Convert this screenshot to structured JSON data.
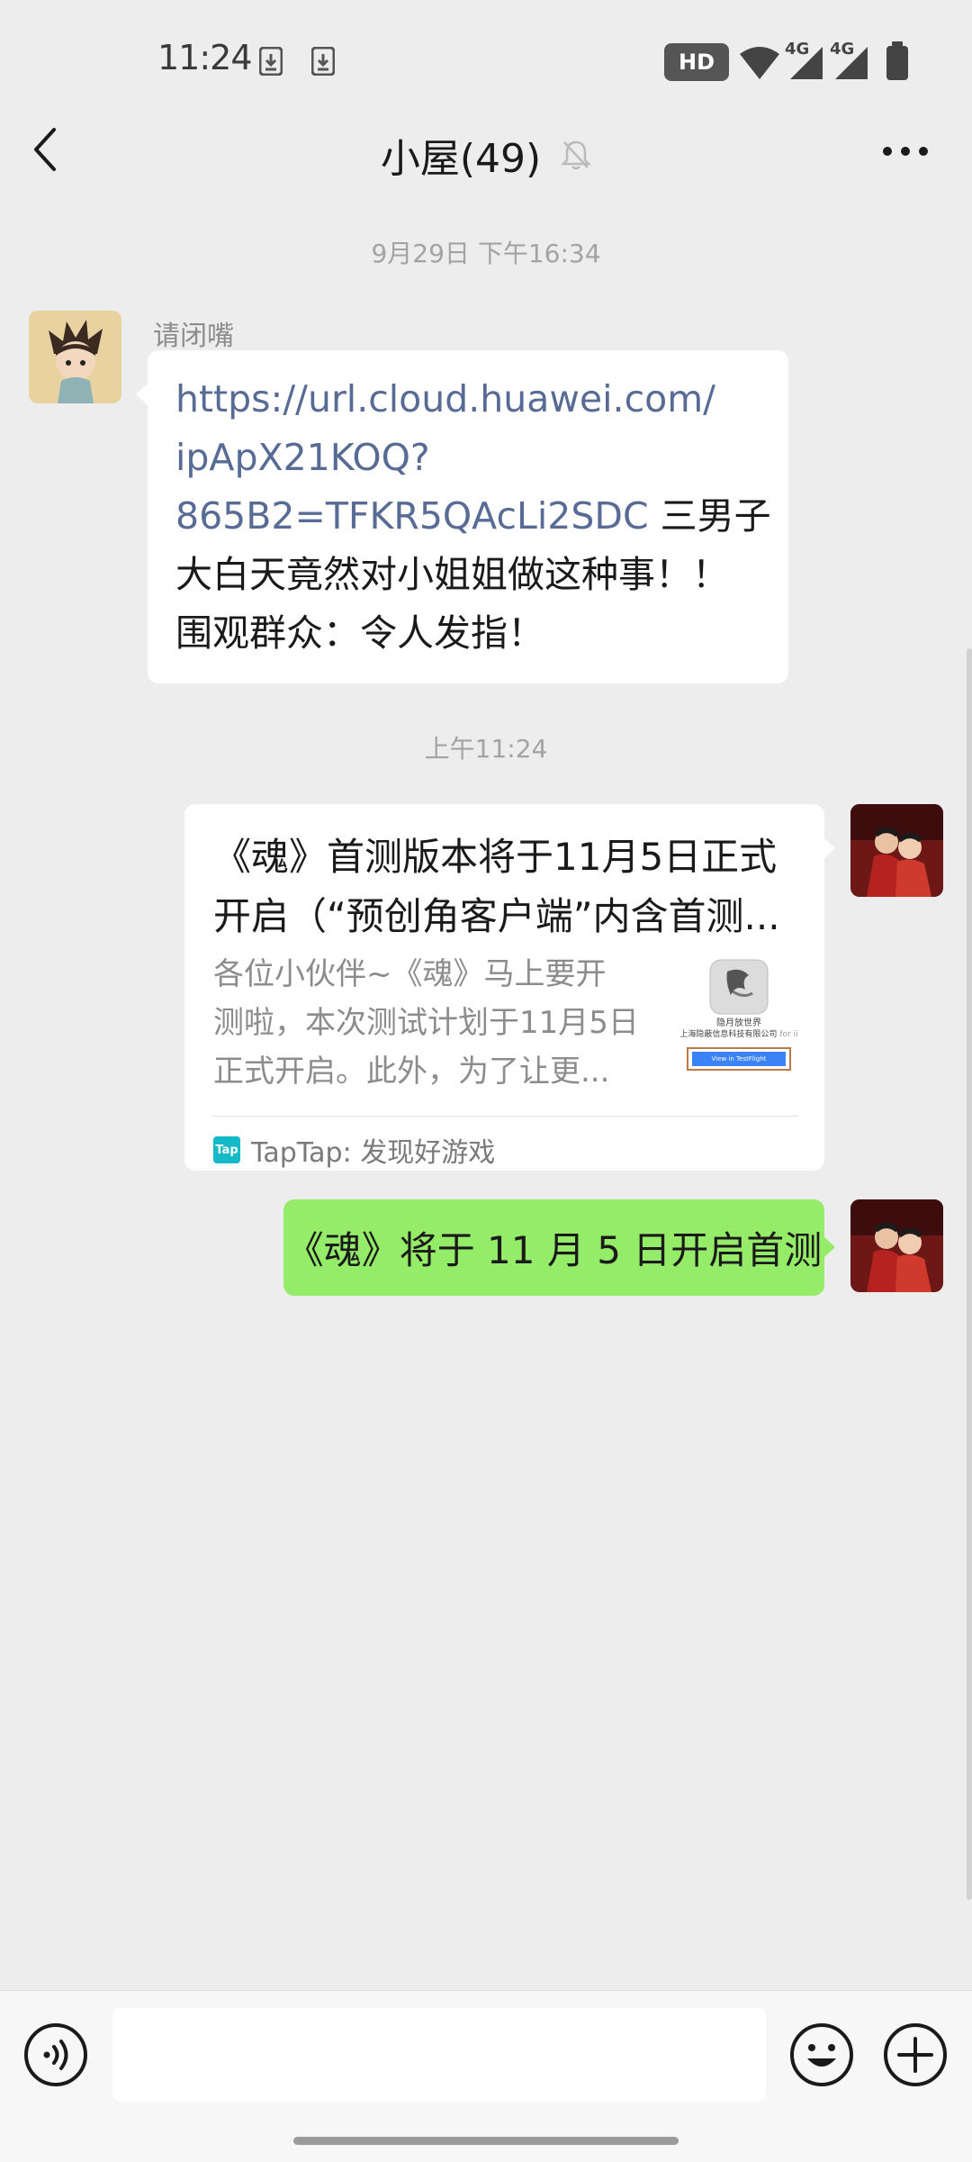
{
  "status_bar": {
    "time": "11:24",
    "hd_label": "HD",
    "network_labels": [
      "4G",
      "4G"
    ],
    "icons": [
      "download-icon",
      "download-icon",
      "hd-icon",
      "wifi-icon",
      "signal-icon",
      "signal-icon",
      "battery-icon"
    ]
  },
  "header": {
    "title": "小屋(49)",
    "back_icon": "chevron-left-icon",
    "mute_icon": "bell-muted-icon",
    "more_icon": "more-dots-icon"
  },
  "messages": [
    {
      "type": "timestamp",
      "text": "9月29日 下午16:34"
    },
    {
      "type": "text",
      "direction": "incoming",
      "sender": "请闭嘴",
      "link": "https://url.cloud.huawei.com/ipApX21KOQ?865B2=TFKR5QAcLi2SDC",
      "link_lines": [
        "https://url.cloud.huawei.com/",
        "ipApX21KOQ?",
        "865B2=TFKR5QAcLi2SDC"
      ],
      "text_tail": " 三男子",
      "text_lines": [
        "大白天竟然对小姐姐做这种事！！",
        "围观群众：令人发指！"
      ]
    },
    {
      "type": "timestamp",
      "text": "上午11:24"
    },
    {
      "type": "link_card",
      "direction": "outgoing",
      "title_lines": [
        "《魂》首测版本将于11月5日正式",
        "开启（“预创角客户端”内含首测..."
      ],
      "desc_lines": [
        "各位小伙伴~《魂》马上要开",
        "测啦，本次测试计划于11月5日",
        "正式开启。此外，为了让更..."
      ],
      "thumbnail": {
        "caption_1": "隐月放世界",
        "caption_2": "上海隐蔽信息科技有限公司",
        "caption_3": "for ii",
        "button": "View in TestFlight"
      },
      "source_logo": "Tap",
      "source": "TapTap: 发现好游戏"
    },
    {
      "type": "text",
      "direction": "outgoing",
      "text": "《魂》将于 11 月 5 日开启首测"
    }
  ],
  "input_bar": {
    "voice_icon": "voice-icon",
    "input_value": "",
    "emoji_icon": "emoji-icon",
    "plus_icon": "plus-icon"
  },
  "colors": {
    "background": "#ededed",
    "outgoing_bubble": "#95ec69",
    "incoming_bubble": "#ffffff",
    "link": "#576b95",
    "timestamp": "#a3a3a3",
    "taptap_brand": "#14b9c8"
  }
}
